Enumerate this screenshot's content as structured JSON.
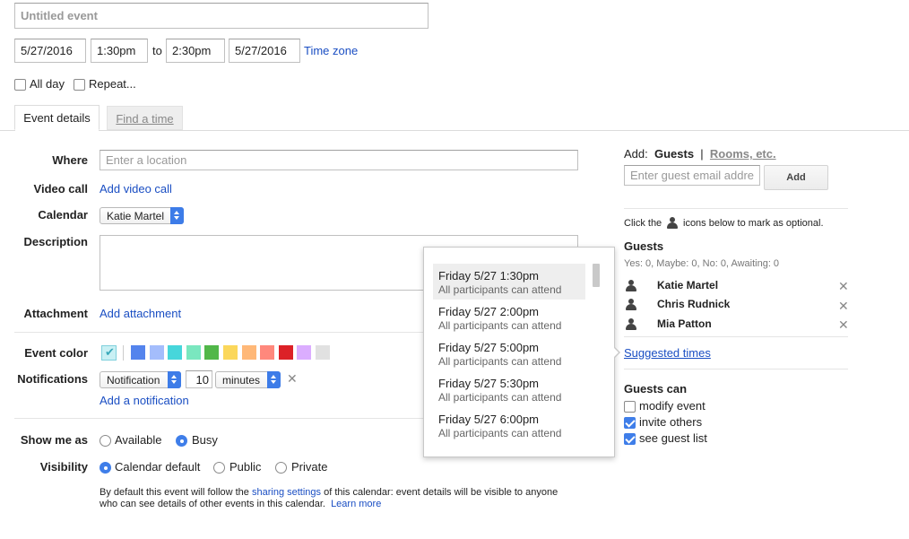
{
  "event": {
    "title_placeholder": "Untitled event",
    "start_date": "5/27/2016",
    "start_time": "1:30pm",
    "to_label": "to",
    "end_time": "2:30pm",
    "end_date": "5/27/2016",
    "timezone_link": "Time zone",
    "all_day_label": "All day",
    "repeat_label": "Repeat..."
  },
  "tabs": [
    {
      "label": "Event details",
      "active": true
    },
    {
      "label": "Find a time",
      "active": false
    }
  ],
  "details": {
    "where_label": "Where",
    "where_placeholder": "Enter a location",
    "video_label": "Video call",
    "video_link": "Add video call",
    "calendar_label": "Calendar",
    "calendar_value": "Katie Martel",
    "description_label": "Description",
    "attachment_label": "Attachment",
    "attachment_link": "Add attachment",
    "color_label": "Event color",
    "colors": [
      "#5484ed",
      "#a4bdfc",
      "#46d6db",
      "#7ae7bf",
      "#51b749",
      "#fbd75b",
      "#ffb878",
      "#ff887c",
      "#dc2127",
      "#dbadff",
      "#e1e1e1"
    ],
    "notifications_label": "Notifications",
    "notification_type": "Notification",
    "notification_amount": "10",
    "notification_unit": "minutes",
    "add_notification_link": "Add a notification",
    "show_me_as_label": "Show me as",
    "available_label": "Available",
    "busy_label": "Busy",
    "visibility_label": "Visibility",
    "calendar_default_label": "Calendar default",
    "public_label": "Public",
    "private_label": "Private",
    "info_line1_pre": "By default this event will follow the ",
    "info_sharing_link": "sharing settings",
    "info_line1_post": " of this calendar: event details will be visible to anyone",
    "info_line2": "who can see details of other events in this calendar.",
    "learn_more_link": "Learn more"
  },
  "suggestions": [
    {
      "time": "Friday 5/27 1:30pm",
      "note": "All participants can attend"
    },
    {
      "time": "Friday 5/27 2:00pm",
      "note": "All participants can attend"
    },
    {
      "time": "Friday 5/27 5:00pm",
      "note": "All participants can attend"
    },
    {
      "time": "Friday 5/27 5:30pm",
      "note": "All participants can attend"
    },
    {
      "time": "Friday 5/27 6:00pm",
      "note": "All participants can attend"
    }
  ],
  "guests_panel": {
    "add_label": "Add:",
    "guests_tab": "Guests",
    "separator": "|",
    "rooms_tab": "Rooms, etc.",
    "email_placeholder": "Enter guest email address",
    "add_button": "Add",
    "hint_pre": "Click the",
    "hint_post": "icons below to mark as optional.",
    "guests_heading": "Guests",
    "rsvp_summary": "Yes: 0, Maybe: 0, No: 0, Awaiting: 0",
    "guests": [
      "Katie Martel",
      "Chris Rudnick",
      "Mia Patton"
    ],
    "suggested_times_link": "Suggested times",
    "guests_can_heading": "Guests can",
    "permissions": [
      {
        "label": "modify event",
        "checked": false
      },
      {
        "label": "invite others",
        "checked": true
      },
      {
        "label": "see guest list",
        "checked": true
      }
    ]
  }
}
